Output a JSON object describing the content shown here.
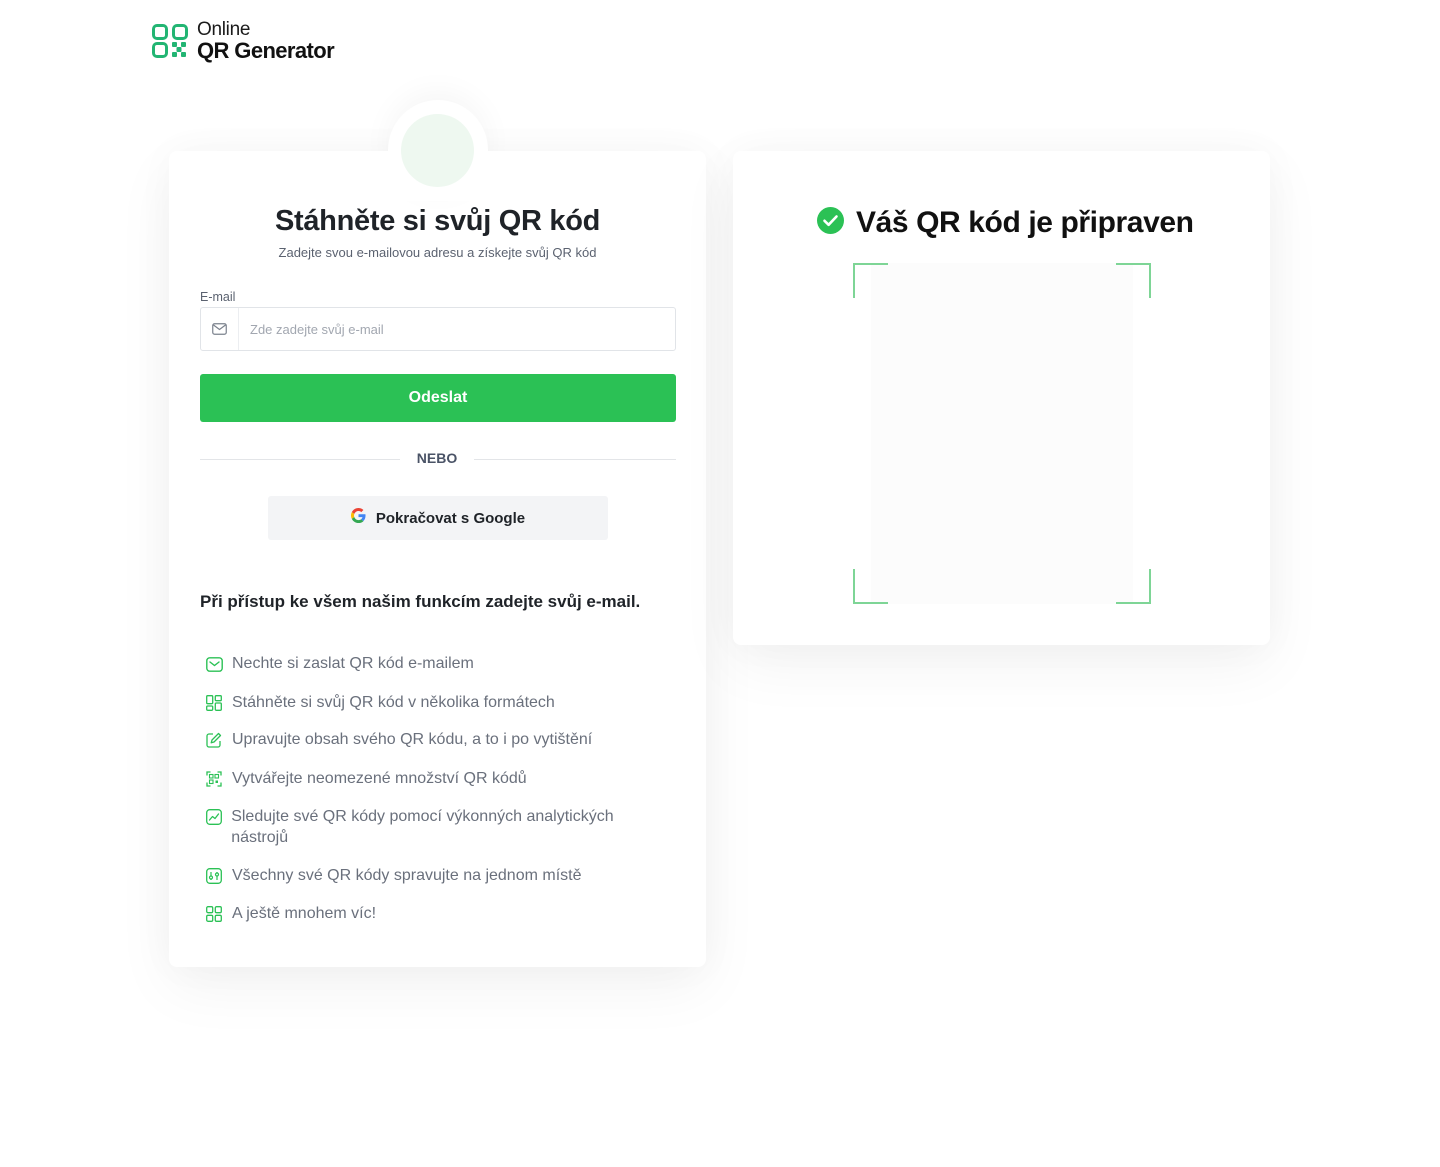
{
  "brand": {
    "line1": "Online",
    "line2": "QR Generator",
    "color": "#2bc155"
  },
  "left_card": {
    "title": "Stáhněte si svůj QR kód",
    "subtitle": "Zadejte svou e-mailovou adresu a získejte svůj QR kód",
    "email": {
      "label": "E-mail",
      "placeholder": "Zde zadejte svůj e-mail",
      "value": ""
    },
    "submit_label": "Odeslat",
    "divider_label": "NEBO",
    "google_label": "Pokračovat s Google",
    "features_title": "Při přístup ke všem našim funkcím zadejte svůj e-mail.",
    "features": [
      {
        "icon": "mail-icon",
        "text": "Nechte si zaslat QR kód e-mailem"
      },
      {
        "icon": "formats-grid-icon",
        "text": "Stáhněte si svůj QR kód v několika formátech"
      },
      {
        "icon": "edit-icon",
        "text": "Upravujte obsah svého QR kódu, a to i po vytištění"
      },
      {
        "icon": "qr-scan-icon",
        "text": "Vytvářejte neomezené množství QR kódů"
      },
      {
        "icon": "analytics-icon",
        "text": "Sledujte své QR kódy pomocí výkonných analytických nástrojů"
      },
      {
        "icon": "manage-icon",
        "text": "Všechny své QR kódy spravujte na jednom místě"
      },
      {
        "icon": "apps-icon",
        "text": "A ještě mnohem víc!"
      }
    ]
  },
  "right_card": {
    "title": "Váš QR kód je připraven",
    "check_icon": "check-circle-icon",
    "accent": "#2bc155",
    "frame_color": "#7ed596"
  }
}
